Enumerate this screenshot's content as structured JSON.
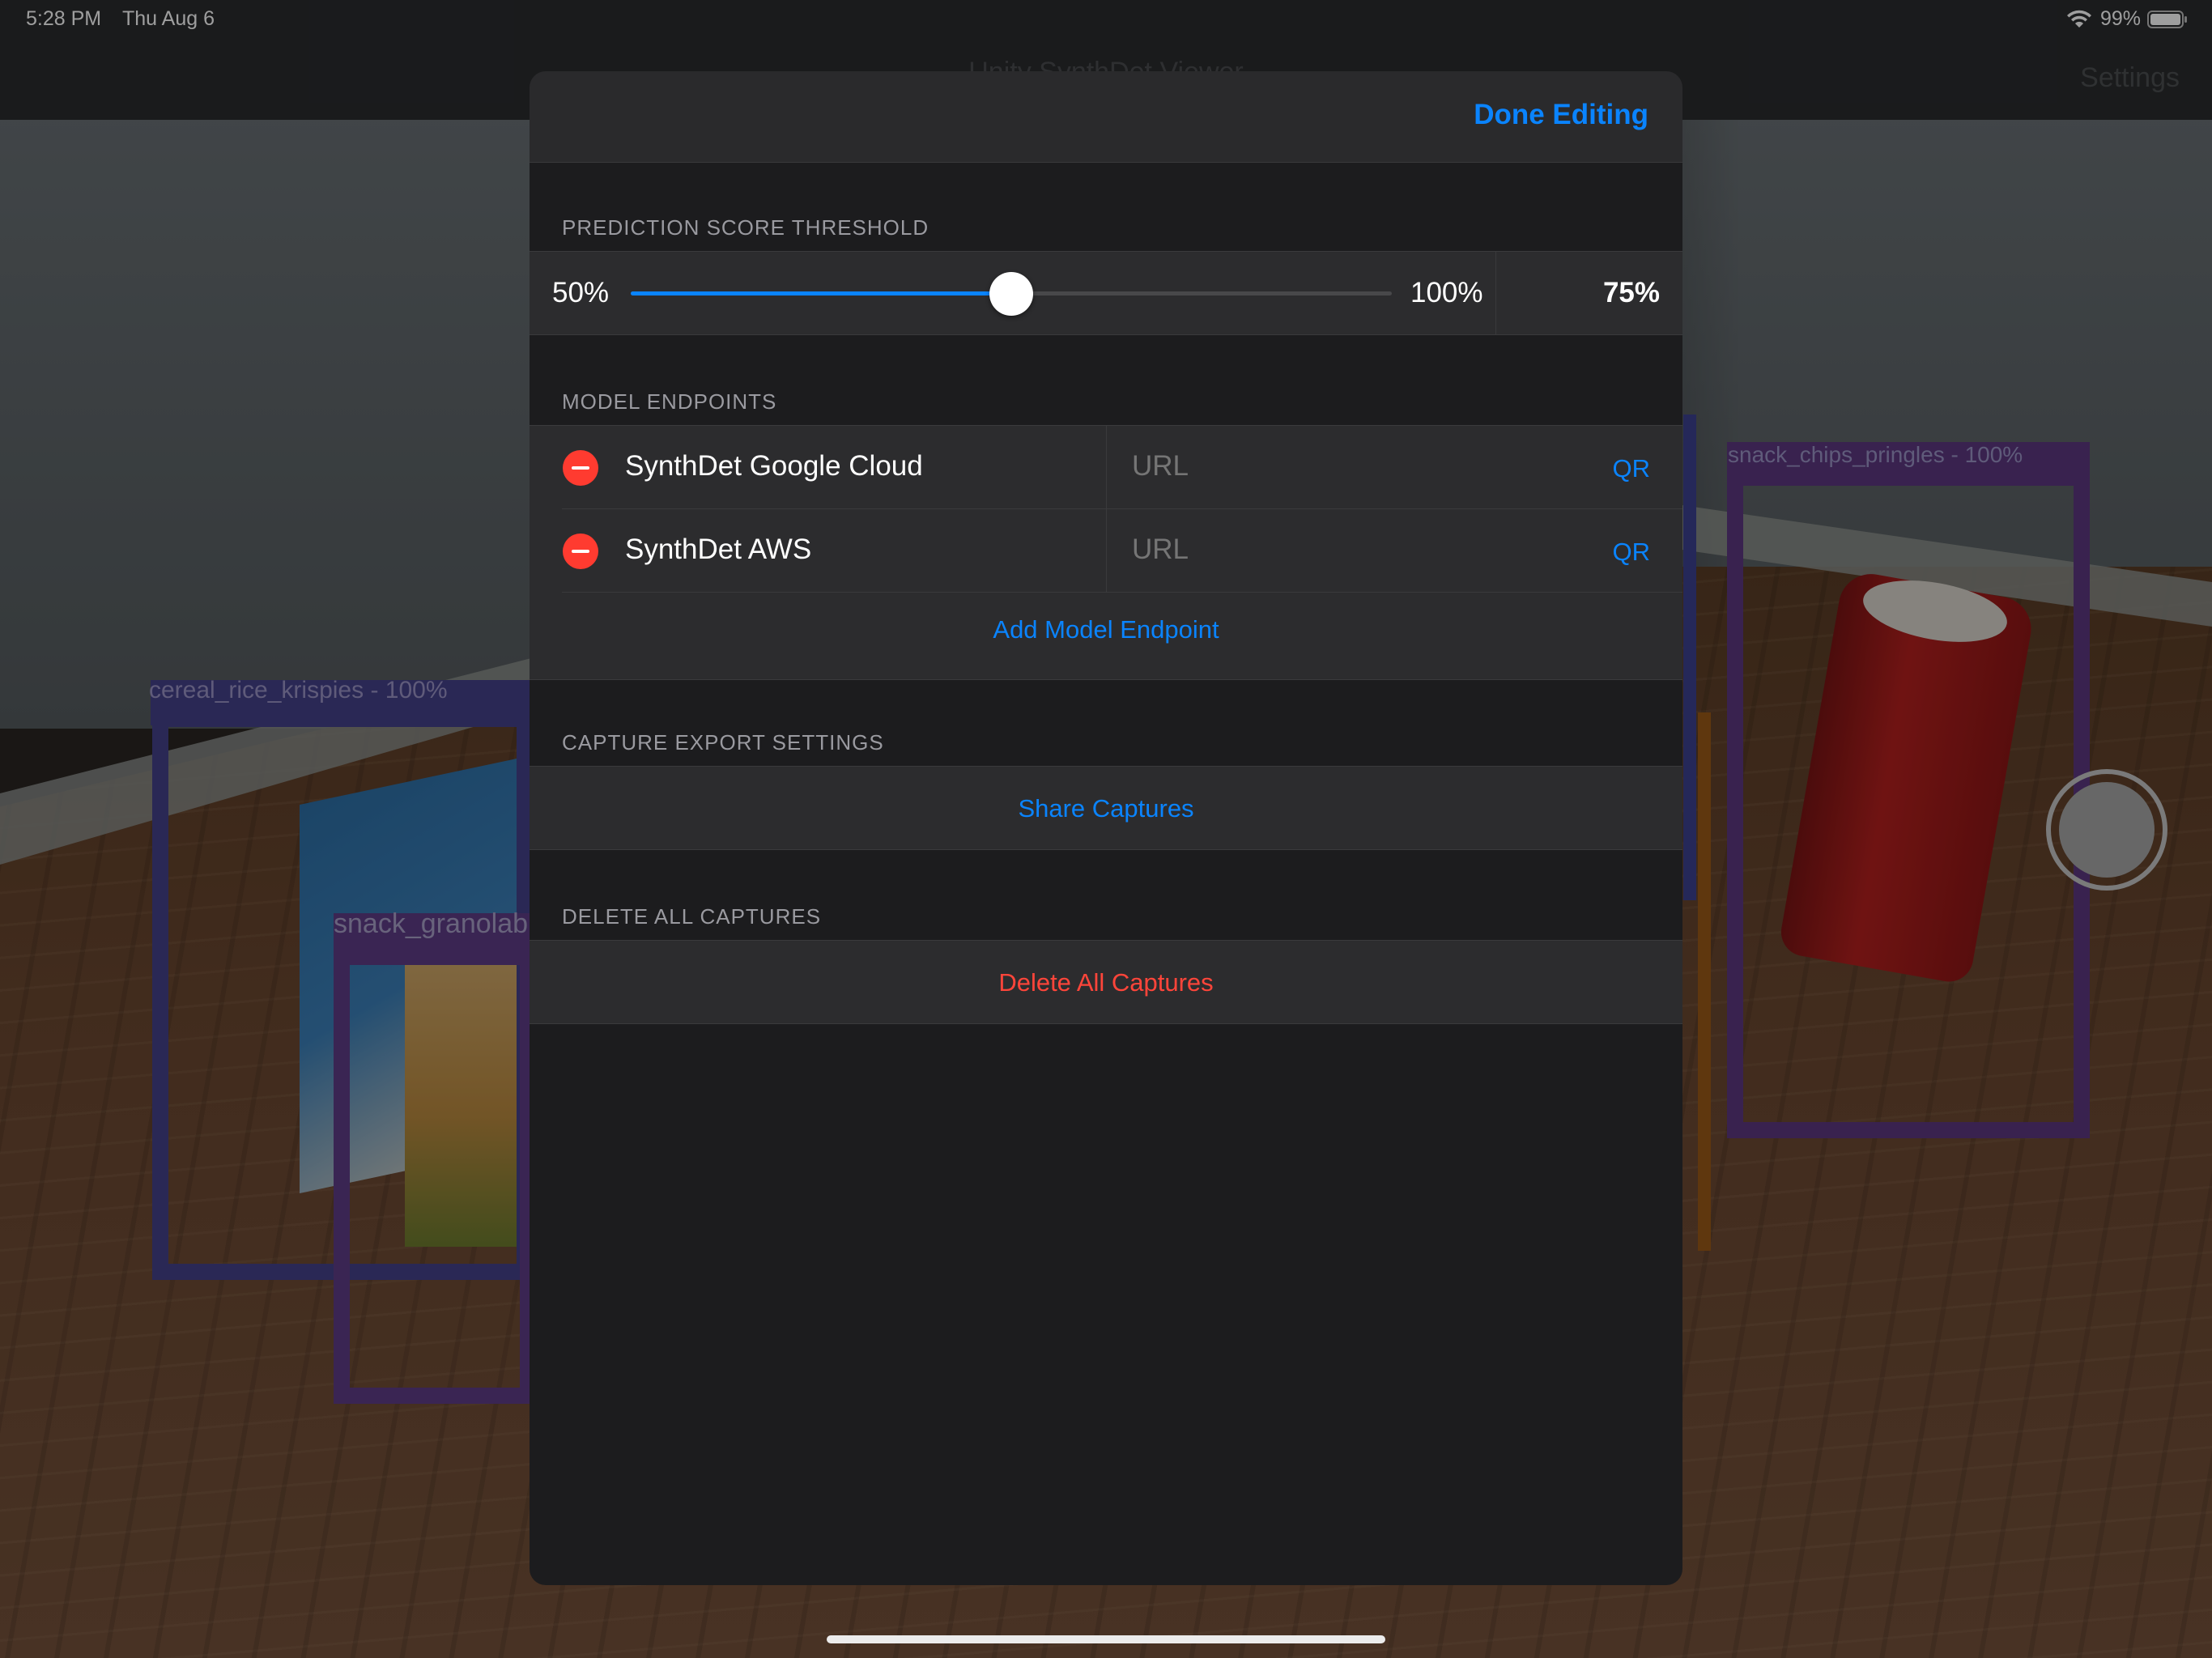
{
  "status_bar": {
    "time": "5:28 PM",
    "date": "Thu Aug 6",
    "battery": "99%"
  },
  "nav": {
    "title": "Unity SynthDet Viewer",
    "settings_label": "Settings"
  },
  "detections": [
    {
      "label": "cereal_rice_krispies - 100%",
      "color": "#45418a"
    },
    {
      "label": "snack_granolab",
      "color": "#5e3c86"
    },
    {
      "label": "snack_chips_pringles - 100%",
      "color": "#5c3880"
    }
  ],
  "sheet": {
    "done_label": "Done Editing",
    "threshold": {
      "header": "PREDICTION SCORE THRESHOLD",
      "min_label": "50%",
      "max_label": "100%",
      "value_label": "75%",
      "fraction": 0.5
    },
    "endpoints": {
      "header": "MODEL ENDPOINTS",
      "items": [
        {
          "name": "SynthDet Google Cloud",
          "url_placeholder": "URL",
          "qr_label": "QR"
        },
        {
          "name": "SynthDet AWS",
          "url_placeholder": "URL",
          "qr_label": "QR"
        }
      ],
      "add_label": "Add Model Endpoint"
    },
    "export": {
      "header": "CAPTURE EXPORT SETTINGS",
      "share_label": "Share Captures"
    },
    "delete": {
      "header": "DELETE ALL CAPTURES",
      "delete_label": "Delete All Captures"
    }
  },
  "colors": {
    "accent": "#0a84ff",
    "destructive": "#ff453a",
    "remove": "#ff3b30"
  }
}
